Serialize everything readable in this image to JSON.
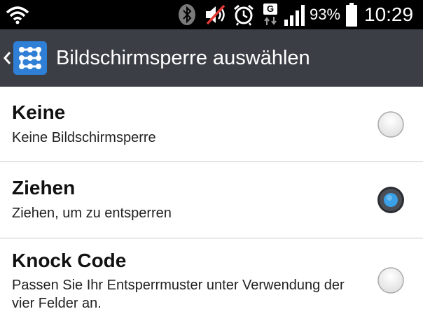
{
  "status_bar": {
    "icons": {
      "wifi": "wifi-icon",
      "bluetooth": "bluetooth-icon",
      "mute": "sound-muted-icon",
      "alarm": "alarm-clock-icon",
      "network": "mobile-data-icon",
      "signal": "signal-strength-icon",
      "battery": "battery-icon"
    },
    "network_type": "G",
    "battery_percent": "93%",
    "time": "10:29"
  },
  "action_bar": {
    "back_icon": "chevron-left-icon",
    "app_icon": "lock-pattern-icon",
    "title": "Bildschirmsperre auswählen",
    "background": "#3b3f45",
    "icon_color": "#2f7fd6"
  },
  "options": [
    {
      "title": "Keine",
      "description": "Keine Bildschirmsperre",
      "selected": false
    },
    {
      "title": "Ziehen",
      "description": "Ziehen, um zu entsperren",
      "selected": true
    },
    {
      "title": "Knock Code",
      "description": "Passen Sie Ihr Entsperrmuster unter Verwendung der vier Felder an.",
      "selected": false
    }
  ],
  "colors": {
    "radio_selected": "#3aa0e8",
    "divider": "#c9c9c9"
  }
}
